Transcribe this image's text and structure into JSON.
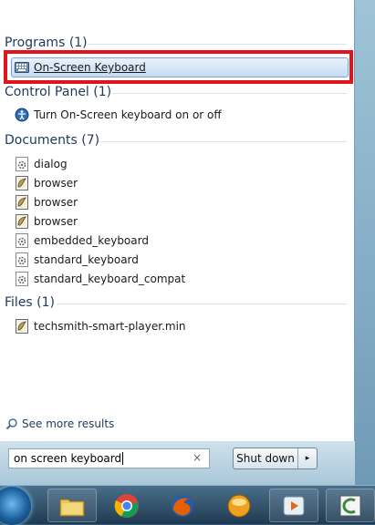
{
  "groups": {
    "programs": {
      "header": "Programs (1)"
    },
    "control_panel": {
      "header": "Control Panel (1)"
    },
    "documents": {
      "header": "Documents (7)"
    },
    "files": {
      "header": "Files (1)"
    }
  },
  "programs_items": [
    {
      "label": "On-Screen Keyboard",
      "icon": "keyboard-icon"
    }
  ],
  "control_panel_items": [
    {
      "label": "Turn On-Screen keyboard on or off",
      "icon": "ease-of-access-icon"
    }
  ],
  "documents_items": [
    {
      "label": "dialog",
      "icon": "gear-document-icon"
    },
    {
      "label": "browser",
      "icon": "script-document-icon"
    },
    {
      "label": "browser",
      "icon": "script-document-icon"
    },
    {
      "label": "browser",
      "icon": "script-document-icon"
    },
    {
      "label": "embedded_keyboard",
      "icon": "gear-document-icon"
    },
    {
      "label": "standard_keyboard",
      "icon": "gear-document-icon"
    },
    {
      "label": "standard_keyboard_compat",
      "icon": "gear-document-icon"
    }
  ],
  "files_items": [
    {
      "label": "techsmith-smart-player.min",
      "icon": "script-document-icon"
    }
  ],
  "see_more": "See more results",
  "search": {
    "value": "on screen keyboard",
    "clear_glyph": "×"
  },
  "shutdown": {
    "label": "Shut down",
    "arrow": "▸"
  },
  "taskbar": {
    "items": [
      {
        "name": "file-explorer-icon"
      },
      {
        "name": "chrome-icon"
      },
      {
        "name": "firefox-icon"
      },
      {
        "name": "app-orb-icon"
      },
      {
        "name": "media-player-icon"
      },
      {
        "name": "camtasia-icon"
      }
    ]
  },
  "colors": {
    "highlight": "#e0141c",
    "header_text": "#1e395b",
    "selection": "#c5dcf3"
  }
}
